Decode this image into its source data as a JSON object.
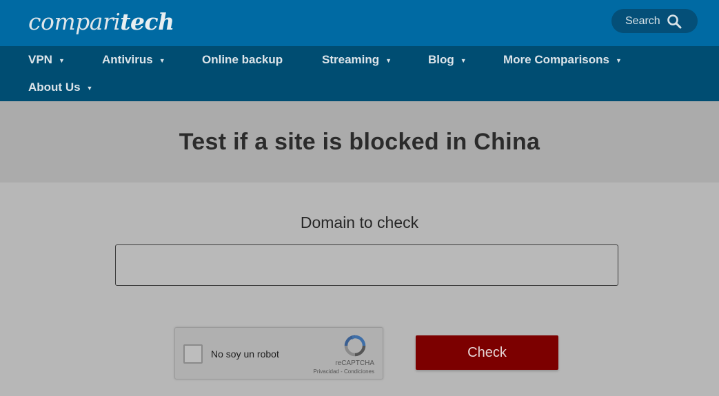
{
  "header": {
    "logo_light": "compari",
    "logo_bold": "tech",
    "search_label": "Search",
    "search_icon": "search-icon"
  },
  "nav": {
    "items": [
      {
        "label": "VPN",
        "has_dropdown": true
      },
      {
        "label": "Antivirus",
        "has_dropdown": true
      },
      {
        "label": "Online backup",
        "has_dropdown": false
      },
      {
        "label": "Streaming",
        "has_dropdown": true
      },
      {
        "label": "Blog",
        "has_dropdown": true
      },
      {
        "label": "More Comparisons",
        "has_dropdown": true
      },
      {
        "label": "About Us",
        "has_dropdown": true
      }
    ],
    "dropdown_glyph": "▼"
  },
  "hero": {
    "title": "Test if a site is blocked in China"
  },
  "form": {
    "domain_label": "Domain to check",
    "domain_value": "",
    "domain_placeholder": "",
    "captcha": {
      "label": "No soy un robot",
      "brand": "reCAPTCHA",
      "links": "Privacidad - Condiciones"
    },
    "check_label": "Check"
  },
  "colors": {
    "header_bg": "#006aa3",
    "nav_bg": "#004d72",
    "check_button": "#7c0000"
  }
}
